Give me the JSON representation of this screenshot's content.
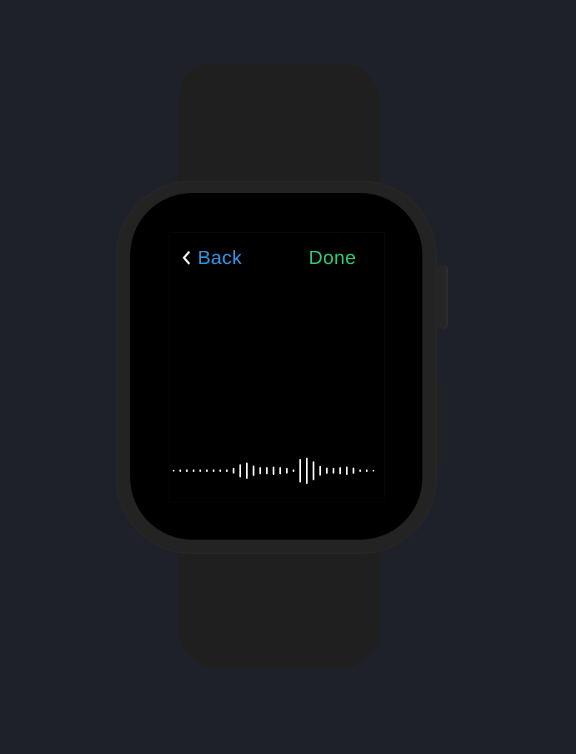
{
  "nav": {
    "back_label": "Back",
    "back_icon": "chevron-left-icon",
    "done_label": "Done"
  },
  "colors": {
    "page_background": "#1e202a",
    "band": "#1f1f1f",
    "case": "#232323",
    "screen": "#000000",
    "back": "#3597e8",
    "done": "#33cf76",
    "waveform": "#ffffff"
  },
  "waveform": {
    "levels": [
      0.06,
      0.1,
      0.1,
      0.1,
      0.1,
      0.1,
      0.1,
      0.1,
      0.1,
      0.22,
      0.5,
      0.62,
      0.4,
      0.28,
      0.28,
      0.32,
      0.28,
      0.22,
      0.1,
      0.9,
      1.0,
      0.72,
      0.38,
      0.24,
      0.22,
      0.28,
      0.32,
      0.24,
      0.1,
      0.1,
      0.06
    ]
  }
}
